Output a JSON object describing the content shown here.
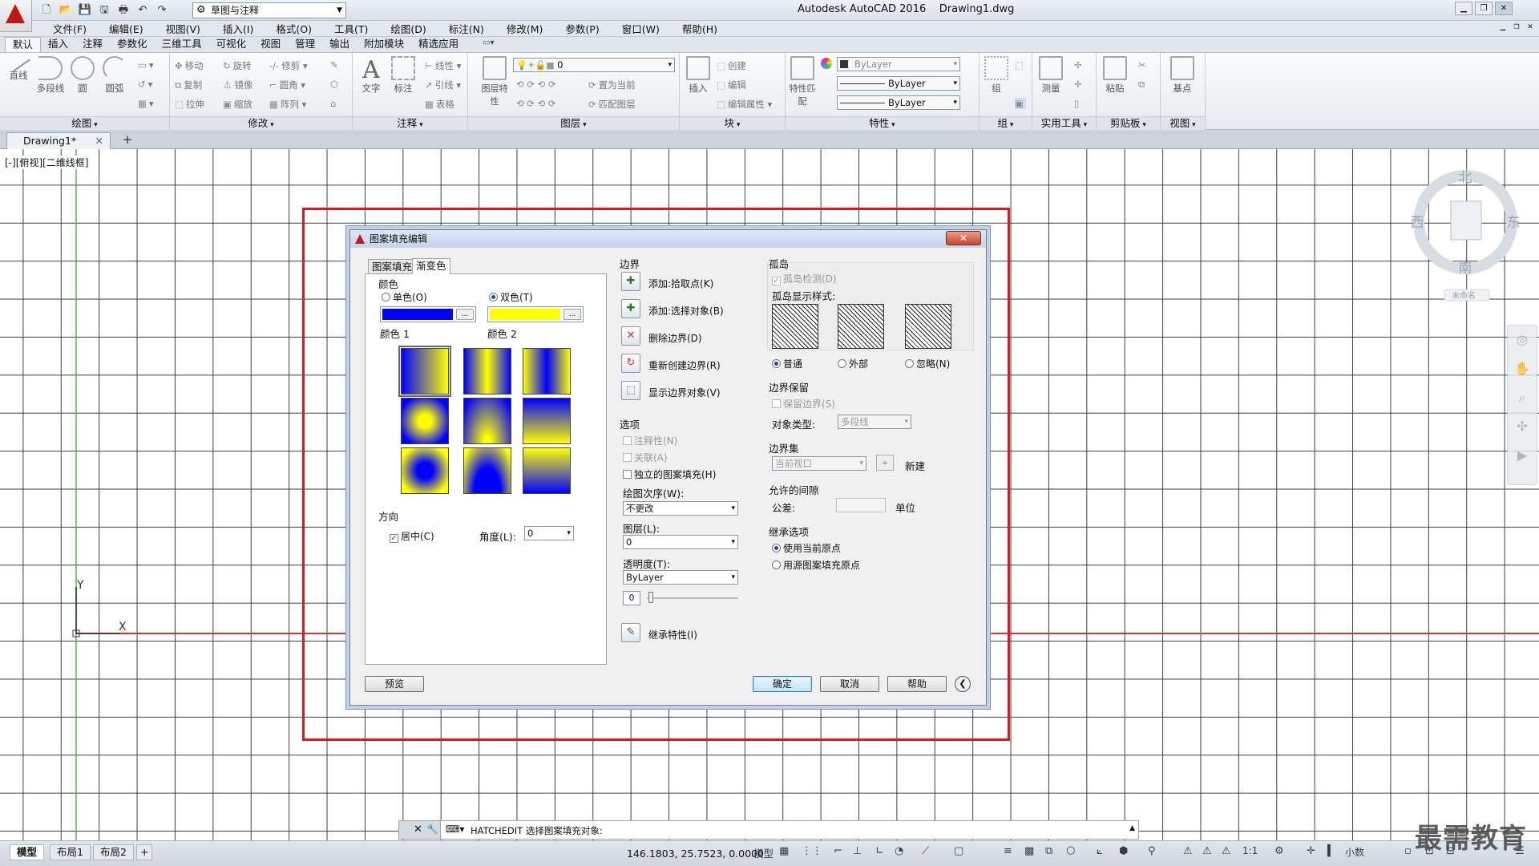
{
  "app": {
    "title": "Autodesk AutoCAD 2016    Drawing1.dwg",
    "workspace": "草图与注释",
    "watermark": "最需教育"
  },
  "menu": [
    "文件(F)",
    "编辑(E)",
    "视图(V)",
    "插入(I)",
    "格式(O)",
    "工具(T)",
    "绘图(D)",
    "标注(N)",
    "修改(M)",
    "参数(P)",
    "窗口(W)",
    "帮助(H)"
  ],
  "ribbon_tabs": [
    "默认",
    "插入",
    "注释",
    "参数化",
    "三维工具",
    "可视化",
    "视图",
    "管理",
    "输出",
    "附加模块",
    "精选应用"
  ],
  "ribbon": {
    "draw": {
      "title": "绘图",
      "line": "直线",
      "polyline": "多段线",
      "circle": "圆",
      "arc": "圆弧"
    },
    "modify": {
      "title": "修改",
      "move": "移动",
      "rotate": "旋转",
      "trim": "修剪",
      "copy": "复制",
      "mirror": "镜像",
      "fillet": "圆角",
      "stretch": "拉伸",
      "scale": "缩放",
      "array": "阵列"
    },
    "annotation": {
      "title": "注释",
      "text": "文字",
      "dimension": "标注",
      "linear": "线性",
      "leader": "引线",
      "table": "表格"
    },
    "layers": {
      "title": "图层",
      "layer_props": "图层特性",
      "current": "0",
      "make_current": "置为当前",
      "match": "匹配图层"
    },
    "block": {
      "title": "块",
      "insert": "插入",
      "create": "创建",
      "edit": "编辑",
      "edit_attr": "编辑属性"
    },
    "properties": {
      "title": "特性",
      "match": "特性匹配",
      "color": "ByLayer",
      "linetype": "ByLayer",
      "lineweight": "ByLayer"
    },
    "groups": {
      "title": "组",
      "group": "组"
    },
    "utilities": {
      "title": "实用工具",
      "measure": "测量"
    },
    "clipboard": {
      "title": "剪贴板",
      "paste": "粘贴"
    },
    "view": {
      "title": "视图",
      "base": "基点"
    }
  },
  "doc_tab": "Drawing1*",
  "viewport_label": "[-][俯视][二维线框]",
  "viewcube": {
    "north": "北",
    "south": "南",
    "east": "东",
    "west": "西",
    "wcs": "未命名"
  },
  "ucs": {
    "x": "X",
    "y": "Y"
  },
  "dialog": {
    "title": "图案填充编辑",
    "tabs": [
      "图案填充",
      "渐变色"
    ],
    "color": {
      "label": "颜色",
      "one_color": "单色(O)",
      "two_color": "双色(T)",
      "color1_label": "颜色 1",
      "color2_label": "颜色 2",
      "color1": "#0000ff",
      "color2": "#ffff00"
    },
    "orientation": {
      "label": "方向",
      "centered": "居中(C)",
      "angle_label": "角度(L):",
      "angle": "0"
    },
    "boundaries": {
      "label": "边界",
      "add_pick": "添加:拾取点(K)",
      "add_select": "添加:选择对象(B)",
      "remove": "删除边界(D)",
      "recreate": "重新创建边界(R)",
      "display": "显示边界对象(V)"
    },
    "options": {
      "label": "选项",
      "annotative": "注释性(N)",
      "associative": "关联(A)",
      "separate": "独立的图案填充(H)",
      "draw_order_label": "绘图次序(W):",
      "draw_order": "不更改",
      "layer_label": "图层(L):",
      "layer": "0",
      "transparency_label": "透明度(T):",
      "transparency": "ByLayer",
      "transparency_value": "0"
    },
    "inherit": "继承特性(I)",
    "islands": {
      "label": "孤岛",
      "detect": "孤岛检测(D)",
      "style_label": "孤岛显示样式:",
      "normal": "普通",
      "outer": "外部",
      "ignore": "忽略(N)"
    },
    "retain": {
      "label": "边界保留",
      "retain": "保留边界(S)",
      "type_label": "对象类型:",
      "type": "多段线"
    },
    "boundary_set": {
      "label": "边界集",
      "value": "当前视口",
      "new": "新建"
    },
    "gap": {
      "label": "允许的间隙",
      "tolerance": "公差:",
      "unit": "单位"
    },
    "inherit_opts": {
      "label": "继承选项",
      "current": "使用当前原点",
      "source": "用源图案填充原点"
    },
    "buttons": {
      "preview": "预览",
      "ok": "确定",
      "cancel": "取消",
      "help": "帮助"
    }
  },
  "command_line": "HATCHEDIT 选择图案填充对象:",
  "status": {
    "layouts": [
      "模型",
      "布局1",
      "布局2"
    ],
    "coords": "146.1803, 25.7523, 0.0000",
    "model": "模型",
    "scale": "1:1",
    "units": "小数"
  }
}
